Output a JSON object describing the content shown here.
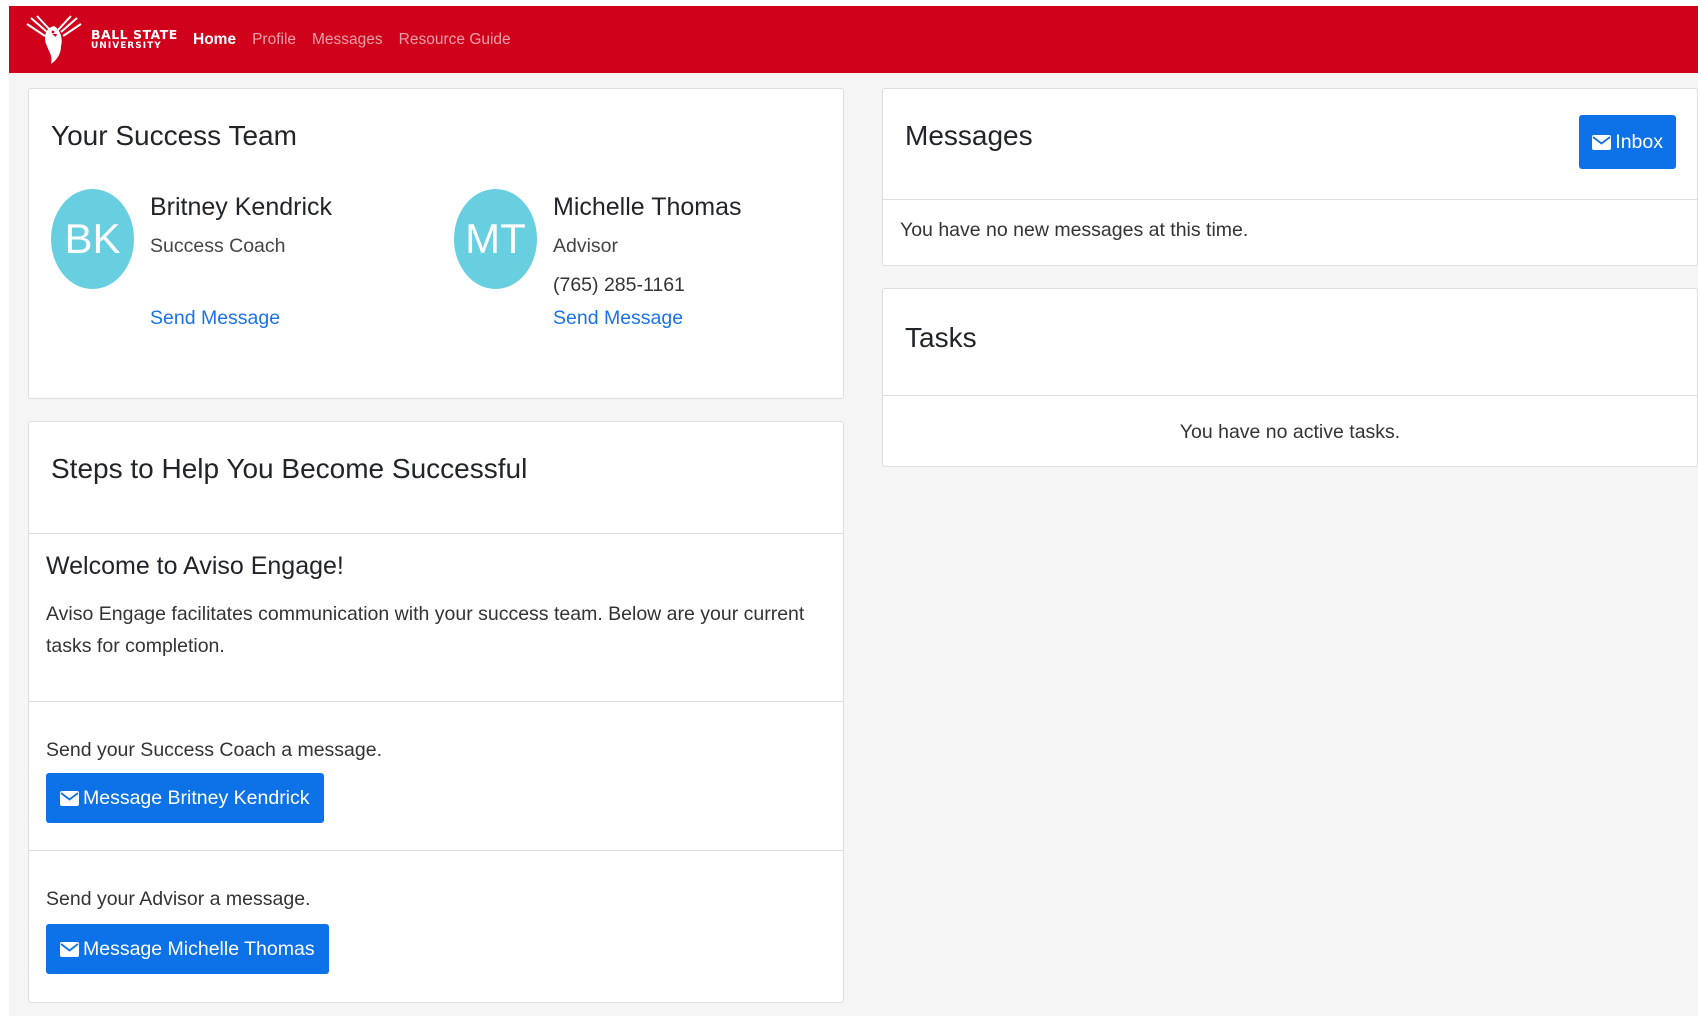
{
  "brand": {
    "line1": "BALL STATE",
    "line2": "UNIVERSITY"
  },
  "nav": {
    "items": [
      {
        "label": "Home",
        "active": true
      },
      {
        "label": "Profile",
        "active": false
      },
      {
        "label": "Messages",
        "active": false
      },
      {
        "label": "Resource Guide",
        "active": false
      }
    ]
  },
  "team": {
    "title": "Your Success Team",
    "members": [
      {
        "initials": "BK",
        "name": "Britney Kendrick",
        "role": "Success Coach",
        "phone": "",
        "link": "Send Message"
      },
      {
        "initials": "MT",
        "name": "Michelle Thomas",
        "role": "Advisor",
        "phone": "(765) 285-1161",
        "link": "Send Message"
      }
    ]
  },
  "steps": {
    "title": "Steps to Help You Become Successful",
    "welcome_heading": "Welcome to Aviso Engage!",
    "welcome_text": "Aviso Engage facilitates communication with your success team. Below are your current tasks for completion.",
    "step1_text": "Send your Success Coach a message.",
    "step1_button": "Message Britney Kendrick",
    "step2_text": "Send your Advisor a message.",
    "step2_button": "Message Michelle Thomas"
  },
  "messages": {
    "title": "Messages",
    "inbox_label": "Inbox",
    "empty_text": "You have no new messages at this time."
  },
  "tasks": {
    "title": "Tasks",
    "empty_text": "You have no active tasks."
  },
  "colors": {
    "navbar": "#d0021b",
    "avatar": "#67cfdf",
    "primary": "#0d72e8",
    "link": "#1a73e8"
  }
}
